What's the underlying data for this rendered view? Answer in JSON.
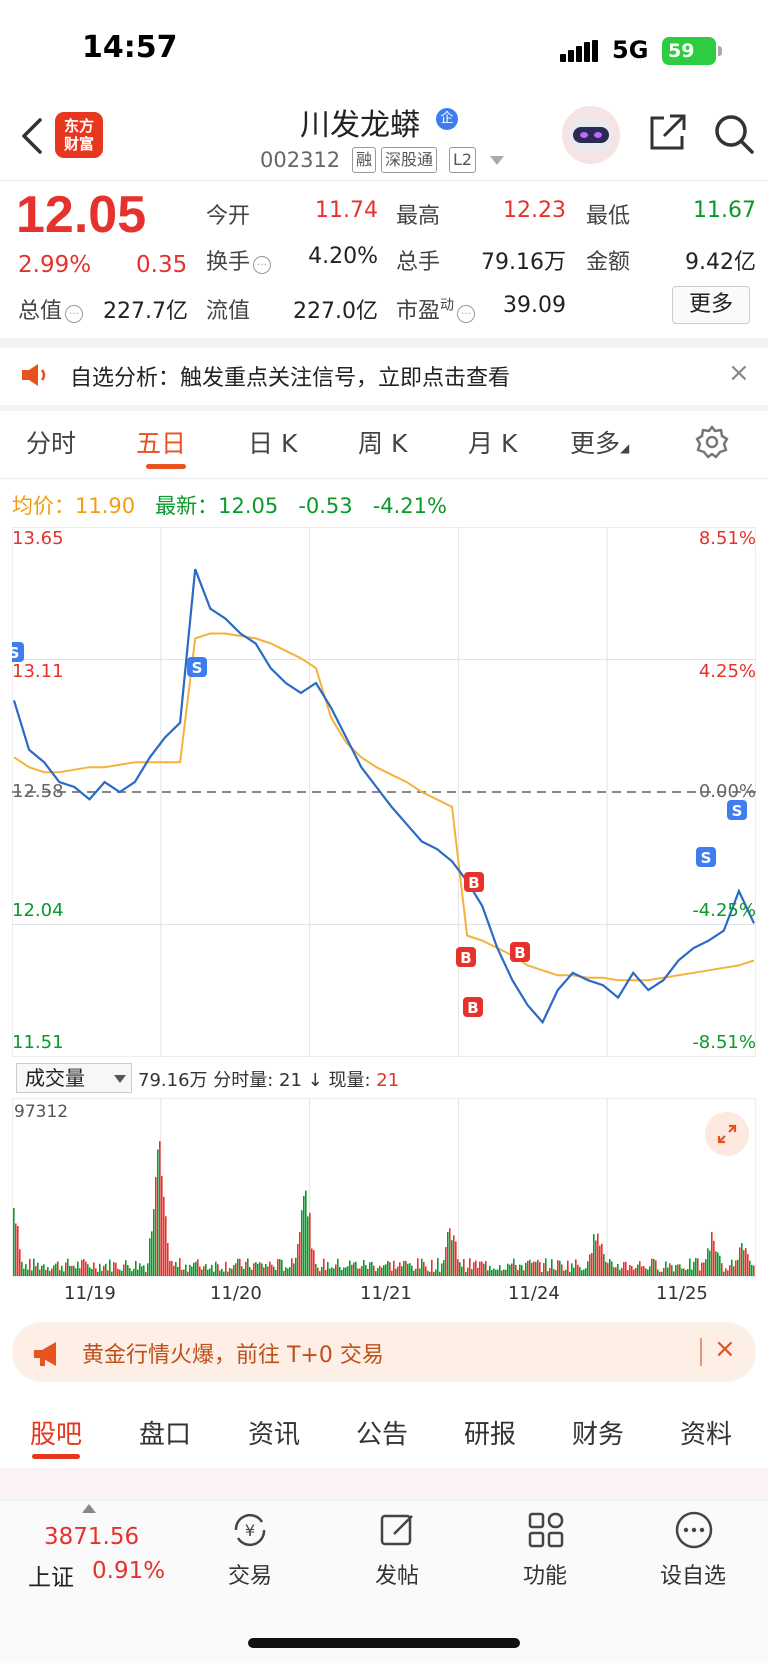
{
  "status_bar": {
    "time": "14:57",
    "network": "5G",
    "battery": "59"
  },
  "header": {
    "logo": "东方\n财富",
    "stock_name": "川发龙蟒",
    "badge": "企",
    "stock_code": "002312",
    "tags": [
      "融",
      "深股通",
      "L2"
    ]
  },
  "quote": {
    "last_price": "12.05",
    "pct_change": "2.99%",
    "abs_change": "0.35",
    "fields": [
      {
        "label": "今开",
        "value": "11.74",
        "color": "#e5322d"
      },
      {
        "label": "最高",
        "value": "12.23",
        "color": "#e5322d"
      },
      {
        "label": "最低",
        "value": "11.67",
        "color": "#0a9a2a"
      },
      {
        "label": "换手",
        "value": "4.20%",
        "color": "#222222"
      },
      {
        "label": "总手",
        "value": "79.16万",
        "color": "#222222"
      },
      {
        "label": "金额",
        "value": "9.42亿",
        "color": "#222222"
      },
      {
        "label": "总值",
        "value": "227.7亿",
        "color": "#222222"
      },
      {
        "label": "流值",
        "value": "227.0亿",
        "color": "#222222"
      },
      {
        "label": "市盈",
        "value": "39.09",
        "color": "#222222",
        "superscript": "动"
      }
    ],
    "more_label": "更多"
  },
  "alert": {
    "text": "自选分析：触发重点关注信号，立即点击查看",
    "close": "×"
  },
  "period_tabs": [
    "分时",
    "五日",
    "日 K",
    "周 K",
    "月 K",
    "更多"
  ],
  "active_period": "五日",
  "avg_row": {
    "avg_label": "均价：",
    "avg_value": "11.90",
    "latest_label": "最新：",
    "latest_value": "12.05",
    "latest_change": "-0.53",
    "latest_pct": "-4.21%"
  },
  "chart_data": {
    "type": "line",
    "title": "",
    "x": [
      "11/19",
      "11/20",
      "11/21",
      "11/24",
      "11/25"
    ],
    "ylim": [
      11.51,
      13.65
    ],
    "y_left_ticks": [
      "13.65",
      "13.11",
      "12.58",
      "12.04",
      "11.51"
    ],
    "y_right_ticks": [
      "8.51%",
      "4.25%",
      "0.00%",
      "-4.25%",
      "-8.51%"
    ],
    "series": [
      {
        "values": [
          12.95,
          12.75,
          12.7,
          12.62,
          12.6,
          12.55,
          12.62,
          12.58,
          12.62,
          12.72,
          12.8,
          12.86,
          13.48,
          13.32,
          13.28,
          13.22,
          13.18,
          13.08,
          13.02,
          12.98,
          13.02,
          12.92,
          12.8,
          12.68,
          12.6,
          12.52,
          12.45,
          12.38,
          12.35,
          12.3,
          12.22,
          12.12,
          11.95,
          11.82,
          11.72,
          11.65,
          11.78,
          11.85,
          11.82,
          11.8,
          11.75,
          11.85,
          11.78,
          11.82,
          11.9,
          11.95,
          11.98,
          12.02,
          12.18,
          12.05
        ]
      },
      {
        "values": [
          12.72,
          12.68,
          12.66,
          12.66,
          12.67,
          12.68,
          12.68,
          12.69,
          12.7,
          12.7,
          12.7,
          12.7,
          13.2,
          13.22,
          13.22,
          13.21,
          13.2,
          13.18,
          13.15,
          13.12,
          13.08,
          12.88,
          12.78,
          12.72,
          12.68,
          12.65,
          12.62,
          12.58,
          12.55,
          12.52,
          12.0,
          11.98,
          11.95,
          11.92,
          11.88,
          11.86,
          11.84,
          11.84,
          11.83,
          11.83,
          11.82,
          11.82,
          11.82,
          11.83,
          11.84,
          11.85,
          11.86,
          11.87,
          11.88,
          11.9
        ]
      }
    ],
    "trade_markers": [
      {
        "label": "S",
        "color": "#3d7df0"
      },
      {
        "label": "S",
        "color": "#3d7df0"
      },
      {
        "label": "B",
        "color": "#e5322d"
      },
      {
        "label": "B",
        "color": "#e5322d"
      },
      {
        "label": "B",
        "color": "#e5322d"
      },
      {
        "label": "B",
        "color": "#e5322d"
      },
      {
        "label": "S",
        "color": "#3d7df0"
      },
      {
        "label": "S",
        "color": "#3d7df0"
      }
    ],
    "colors": {
      "price": "#2a6ac4",
      "avg": "#f4b23a",
      "baseline": "#888888"
    }
  },
  "volume": {
    "selector_label": "成交量",
    "info": "79.16万 分时量: 21 ↓ 现量: ",
    "current_volume": "21",
    "max_label": "97312"
  },
  "date_labels": [
    "11/19",
    "11/20",
    "11/21",
    "11/24",
    "11/25"
  ],
  "promo": {
    "text": "黄金行情火爆，前往 T+0 交易",
    "close": "×"
  },
  "bottom_tabs": [
    "股吧",
    "盘口",
    "资讯",
    "公告",
    "研报",
    "财务",
    "资料"
  ],
  "active_bottom_tab": "股吧",
  "footer": {
    "index_value": "3871.56",
    "index_name": "上证",
    "index_pct": "0.91%",
    "nav": [
      {
        "label": "交易",
        "icon": "yen-exchange-icon"
      },
      {
        "label": "发帖",
        "icon": "edit-post-icon"
      },
      {
        "label": "功能",
        "icon": "grid-apps-icon"
      },
      {
        "label": "设自选",
        "icon": "more-dots-icon"
      }
    ]
  },
  "colors": {
    "up": "#e5322d",
    "down": "#0a9a2a",
    "accent": "#e8521f",
    "avg": "#f39c12"
  }
}
